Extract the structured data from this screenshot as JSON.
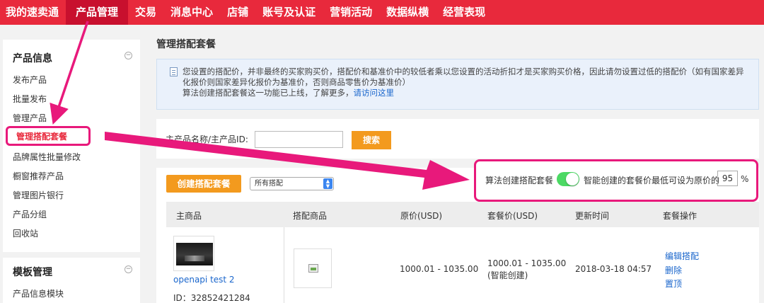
{
  "topnav": {
    "items": [
      "我的速卖通",
      "产品管理",
      "交易",
      "消息中心",
      "店铺",
      "账号及认证",
      "营销活动",
      "数据纵横",
      "经营表现"
    ],
    "active_index": 1
  },
  "sidebar": {
    "sections": [
      {
        "title": "产品信息",
        "items": [
          "发布产品",
          "批量发布",
          "管理产品",
          "管理搭配套餐",
          "品牌属性批量修改",
          "橱窗推荐产品",
          "管理图片银行",
          "产品分组",
          "回收站"
        ],
        "selected_index": 3
      },
      {
        "title": "模板管理",
        "items": [
          "产品信息模块"
        ]
      }
    ],
    "collapse_symbol": "−"
  },
  "main": {
    "title": "管理搭配套餐",
    "notice": {
      "line1": "您设置的搭配价，并非最终的买家购买价，搭配价和基准价中的较低者乘以您设置的活动折扣才是买家购买价格，因此请勿设置过低的搭配价（如有国家差异",
      "line2": "化报价则国家差异化报价为基准价，否则商品零售价为基准价）",
      "line3_text": "算法创建搭配套餐这一功能已上线，了解更多，",
      "line3_link": "请访问这里"
    },
    "search": {
      "label": "主产品名称/主产品ID:",
      "input_value": "",
      "button": "搜索"
    },
    "toolbar": {
      "create_button": "创建搭配套餐",
      "filter_selected": "所有搭配",
      "algo_label": "算法创建搭配套餐",
      "toggle_on": true,
      "min_label": "智能创建的套餐价最低可设为原价的",
      "min_percent": "95",
      "percent_sign": "%"
    },
    "table": {
      "headers": [
        "主商品",
        "搭配商品",
        "原价(USD)",
        "套餐价(USD)",
        "更新时间",
        "套餐操作"
      ],
      "rows": [
        {
          "product_name": "openapi test 2",
          "product_id": "ID：32852421284",
          "original_price": "1000.01 - 1035.00",
          "package_price": "1000.01 - 1035.00",
          "package_note": "(智能创建)",
          "updated": "2018-03-18 04:57",
          "actions": [
            "编辑搭配",
            "删除",
            "置顶"
          ]
        }
      ]
    }
  },
  "colors": {
    "nav_bg": "#e8293c",
    "nav_active": "#c8102e",
    "button_orange": "#f39a1e",
    "link_blue": "#1a66cc",
    "annotation_pink": "#e8197b",
    "toggle_green": "#4cd964"
  },
  "icons": [
    "document-icon",
    "collapse-icon",
    "select-arrow-icon",
    "broken-image-icon",
    "toggle-switch"
  ]
}
